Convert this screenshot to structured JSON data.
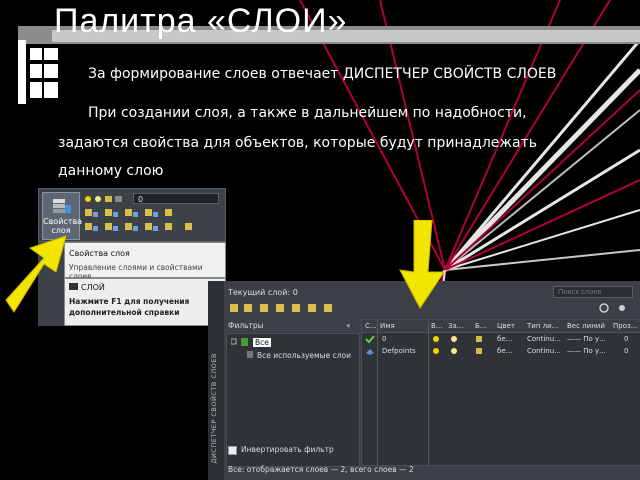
{
  "slide": {
    "title": "Палитра  «СЛОИ»",
    "line1": "За формирование слоев отвечает  ДИСПЕТЧЕР СВОЙСТВ СЛОЕВ",
    "line2": "При создании слоя, а также в дальнейшем по  надобности,",
    "line3": "задаются свойства для объектов,  которые будут принадлежать",
    "line4": "данному слою"
  },
  "ribbon": {
    "button_label_1": "Свойства",
    "button_label_2": "слоя",
    "dropdown_value": "0",
    "tooltip_title": "Свойства слоя",
    "tooltip_desc": "Управление слоями и свойствами слоев",
    "help_title": "СЛОЙ",
    "help_line1": "Нажмите F1 для получения",
    "help_line2": "дополнительной справки"
  },
  "layer_manager": {
    "side_title": "ДИСПЕТЧЕР СВОЙСТВ СЛОЕВ",
    "current_layer": "Текущий слой: 0",
    "search_placeholder": "Поиск слоев",
    "filters_label": "Фильтры",
    "collapse": "«",
    "tree_all": "Все",
    "tree_used": "Все используемые слои",
    "invert_filter": "Инвертировать фильтр",
    "status": "Все: отображается слоев — 2, всего слоев — 2",
    "columns": [
      "С...",
      "Имя",
      "В...",
      "За...",
      "Б...",
      "Цвет",
      "Тип ли...",
      "Вес линий",
      "Проз..."
    ],
    "rows": [
      {
        "name": "0",
        "color": "бе...",
        "ltype": "Continu...",
        "lw": "—— По у...",
        "tr": "0"
      },
      {
        "name": "Defpoints",
        "color": "бе...",
        "ltype": "Continu...",
        "lw": "—— По у...",
        "tr": "0"
      }
    ]
  },
  "colors": {
    "arrow": "#f2e600",
    "ray_red": "#c0003a",
    "ray_white": "#ffffff",
    "panel": "#3c4046"
  }
}
